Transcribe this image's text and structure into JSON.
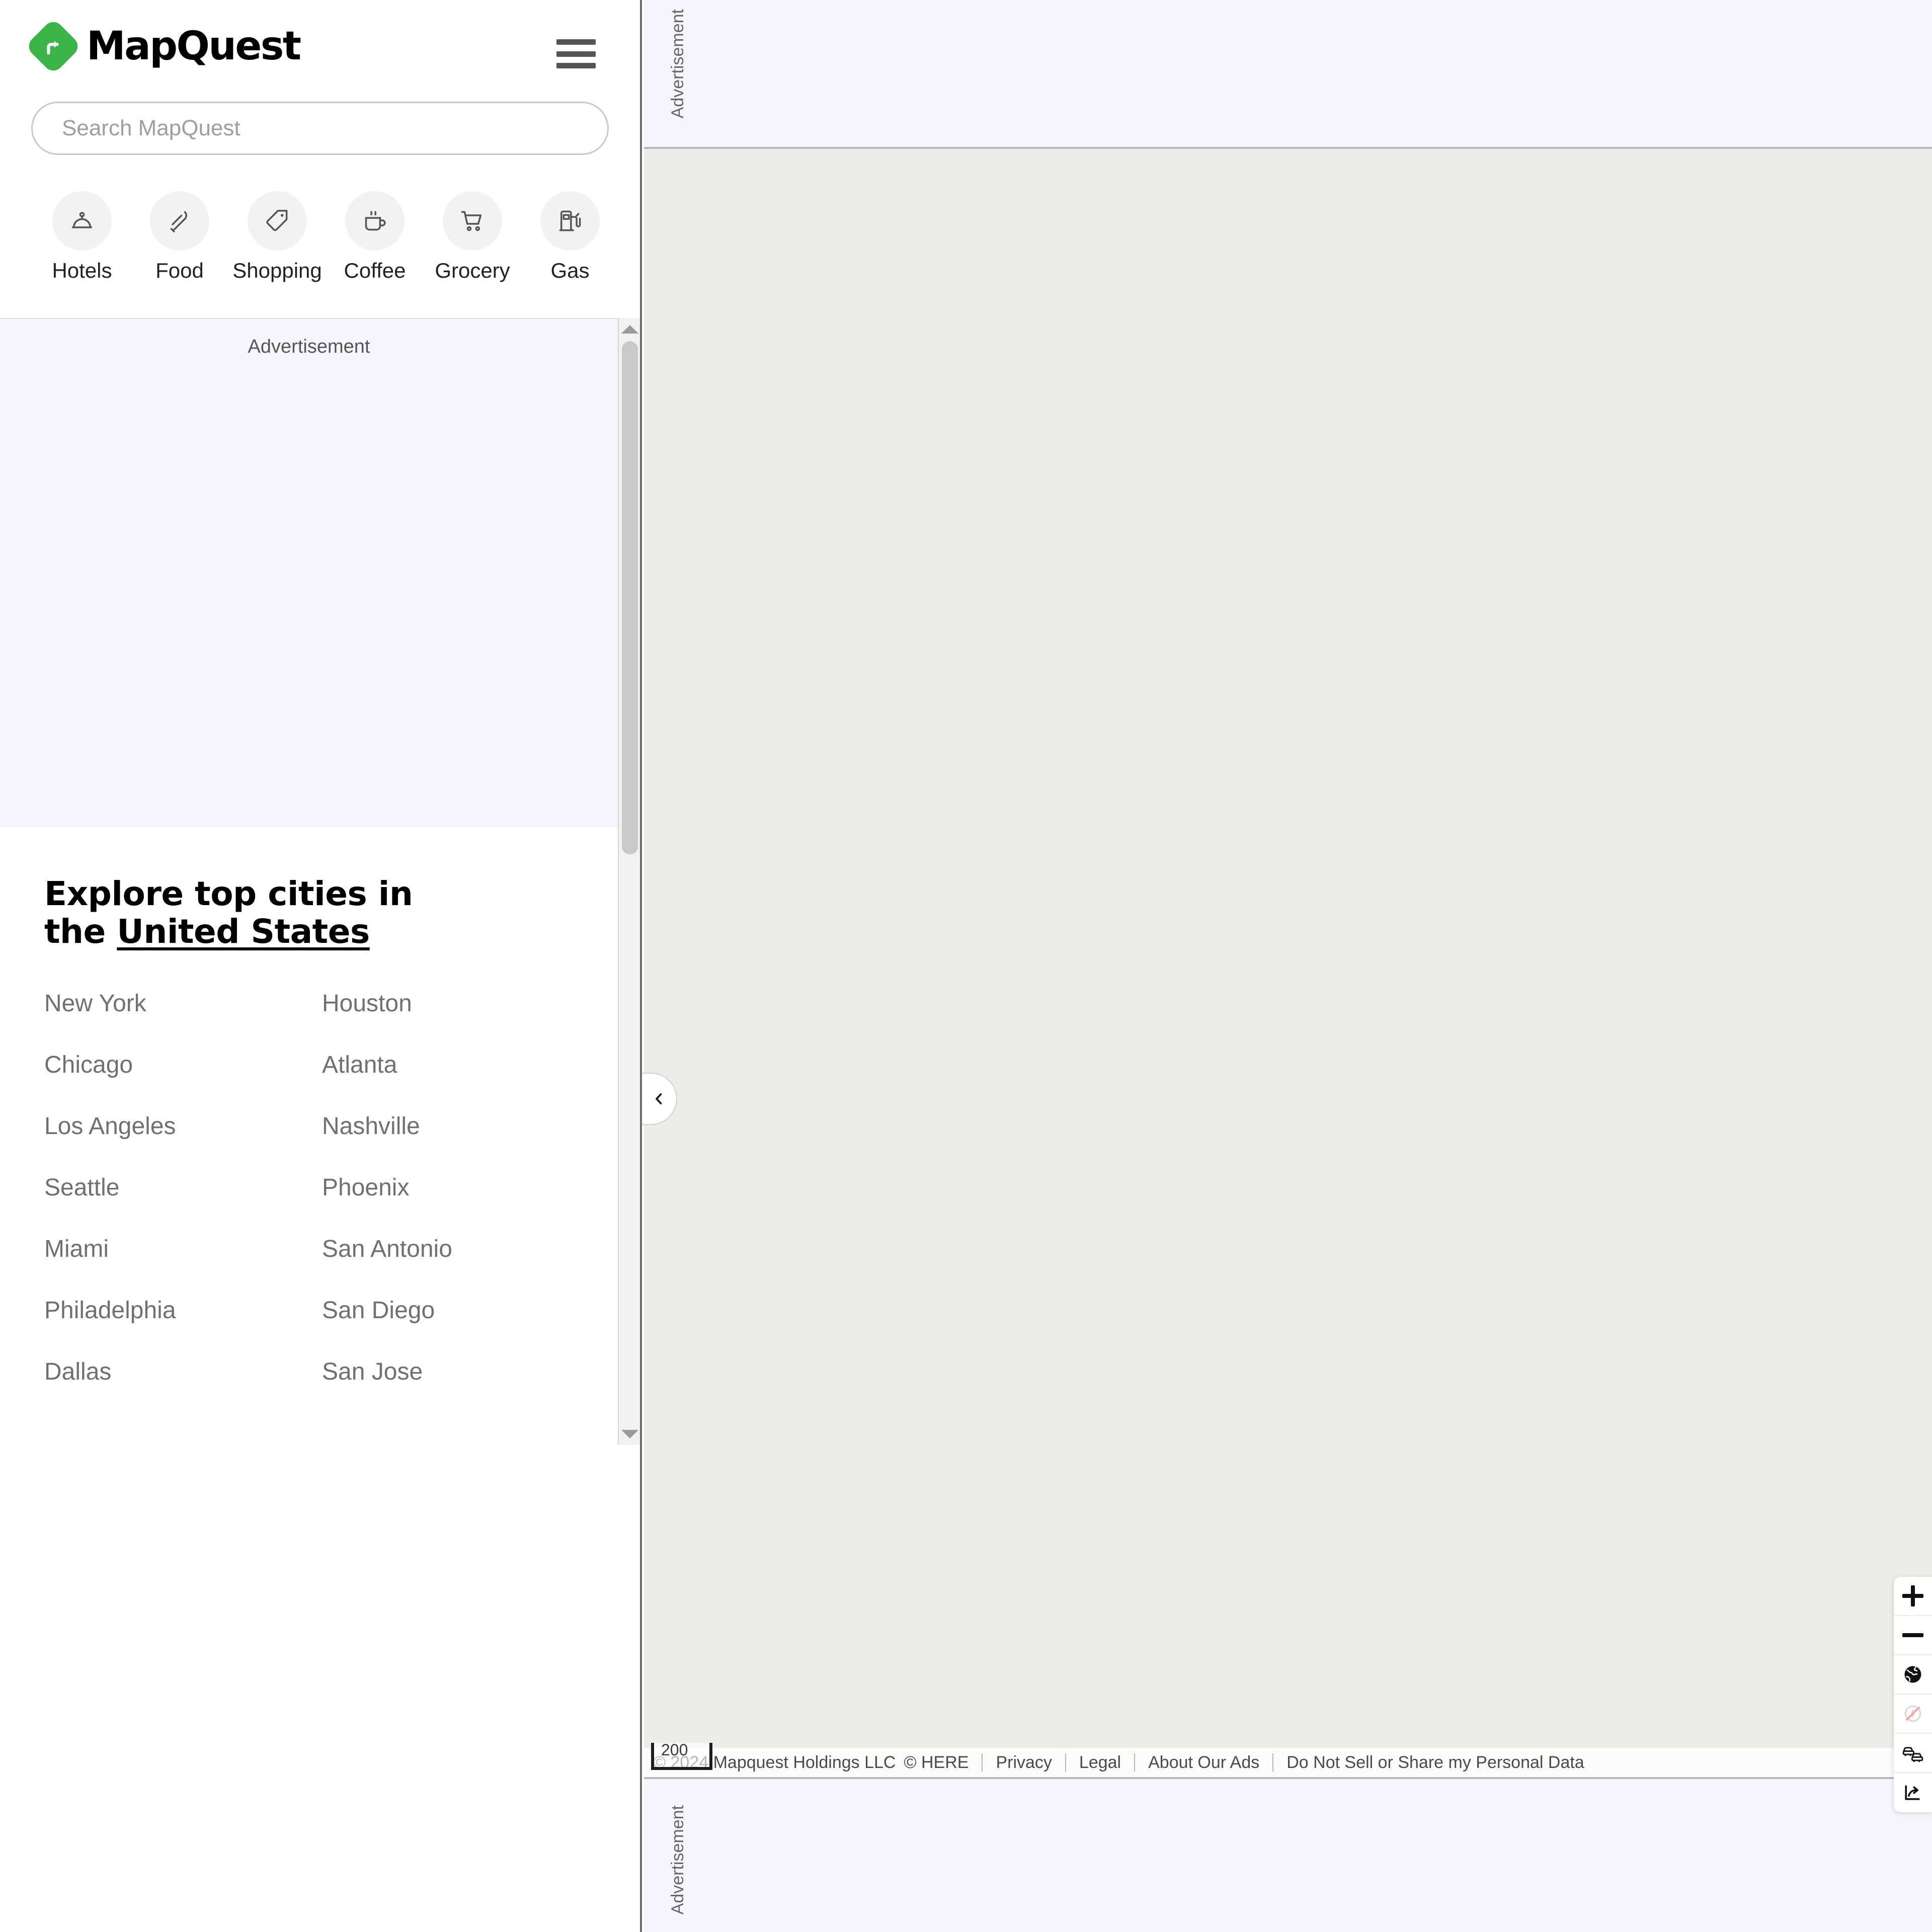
{
  "brand": {
    "name": "MapQuest",
    "logo_icon": "mapquest-turn-arrow-icon",
    "accent_color": "#3cb44a"
  },
  "header": {
    "menu_icon": "hamburger-menu-icon"
  },
  "search": {
    "placeholder": "Search MapQuest",
    "value": "",
    "icon": "search-icon"
  },
  "categories": [
    {
      "label": "Hotels",
      "icon": "hotel-bell-icon"
    },
    {
      "label": "Food",
      "icon": "fork-knife-icon"
    },
    {
      "label": "Shopping",
      "icon": "price-tag-icon"
    },
    {
      "label": "Coffee",
      "icon": "coffee-cup-icon"
    },
    {
      "label": "Grocery",
      "icon": "shopping-cart-icon"
    },
    {
      "label": "Gas",
      "icon": "gas-pump-icon"
    }
  ],
  "sidebar_ad": {
    "label": "Advertisement"
  },
  "cities_section": {
    "title_line1": "Explore top cities in the",
    "title_link": "United States",
    "column_left": [
      "New York",
      "Chicago",
      "Los Angeles",
      "Seattle",
      "Miami",
      "Philadelphia",
      "Dallas"
    ],
    "column_right": [
      "Houston",
      "Atlanta",
      "Nashville",
      "Phoenix",
      "San Antonio",
      "San Diego",
      "San Jose"
    ]
  },
  "ads": {
    "top_label": "Advertisement",
    "bottom_label": "Advertisement"
  },
  "map": {
    "collapse_icon": "chevron-left-icon",
    "background_color": "#eeece6",
    "scale_value": "200",
    "controls": [
      {
        "name": "zoom-in",
        "icon": "plus-icon"
      },
      {
        "name": "zoom-out",
        "icon": "minus-icon"
      },
      {
        "name": "map-type",
        "icon": "globe-icon"
      },
      {
        "name": "compass",
        "icon": "compass-disabled-icon"
      },
      {
        "name": "traffic",
        "icon": "traffic-cars-icon"
      },
      {
        "name": "share",
        "icon": "share-icon"
      }
    ]
  },
  "attribution": {
    "copyright": "© 2024 Mapquest Holdings LLC",
    "data_provider": "© HERE",
    "links": [
      "Privacy",
      "Legal",
      "About Our Ads",
      "Do Not Sell or Share my Personal Data"
    ]
  }
}
